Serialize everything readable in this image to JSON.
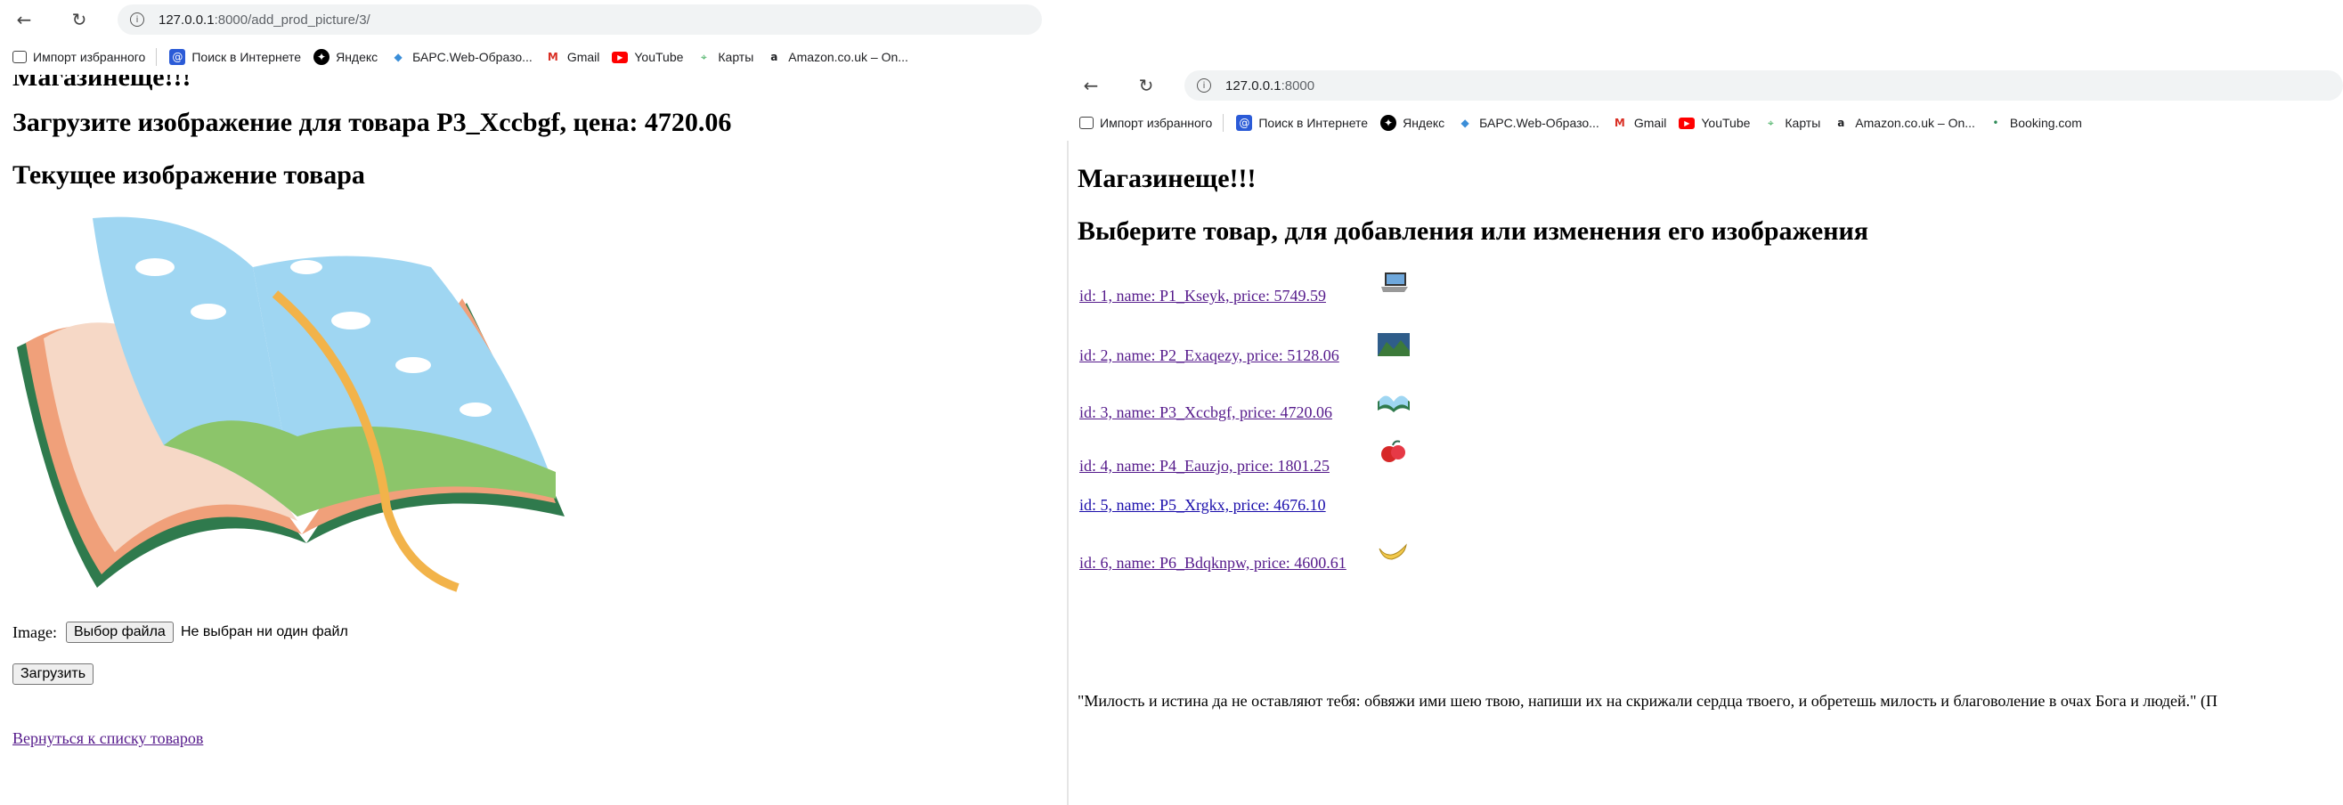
{
  "left": {
    "url_host": "127.0.0.1",
    "url_path": ":8000/add_prod_picture/3/",
    "bookmarks": [
      "Импорт избранного",
      "Поиск в Интернете",
      "Яндекс",
      "БАРС.Web-Образо...",
      "Gmail",
      "YouTube",
      "Карты",
      "Amazon.co.uk – On..."
    ],
    "cut_heading": "Магазинеще!!!",
    "upload_title": "Загрузите изображение для товара P3_Xccbgf, цена: 4720.06",
    "current_title": "Текущее изображение товара",
    "image_label": "Image:",
    "choose_file": "Выбор файла",
    "no_file": "Не выбран ни один файл",
    "upload_button": "Загрузить",
    "back_link": "Вернуться к списку товаров"
  },
  "right": {
    "url_host": "127.0.0.1",
    "url_path": ":8000",
    "bookmarks": [
      "Импорт избранного",
      "Поиск в Интернете",
      "Яндекс",
      "БАРС.Web-Образо...",
      "Gmail",
      "YouTube",
      "Карты",
      "Amazon.co.uk – On...",
      "Booking.com"
    ],
    "shop_title": "Магазинеще!!!",
    "select_title": "Выберите товар, для добавления или изменения его изображения",
    "products": [
      {
        "text": "id: 1, name: P1_Kseyk, price: 5749.59",
        "icon": "laptop-icon"
      },
      {
        "text": "id: 2, name: P2_Exaqezy, price: 5128.06",
        "icon": "landscape-icon"
      },
      {
        "text": "id: 3, name: P3_Xccbgf, price: 4720.06",
        "icon": "book-icon"
      },
      {
        "text": "id: 4, name: P4_Eauzjo, price: 1801.25",
        "icon": "fruit-icon"
      },
      {
        "text": "id: 5, name: P5_Xrgkx, price: 4676.10",
        "icon": ""
      },
      {
        "text": "id: 6, name: P6_Bdqknpw, price: 4600.61",
        "icon": "banana-icon"
      }
    ],
    "quote": "\"Милость и истина да не оставляют тебя: обвяжи ими шею твою, напиши их на скрижали сердца твоего, и обретешь милость и благоволение в очах Бога и людей.\" (П"
  }
}
